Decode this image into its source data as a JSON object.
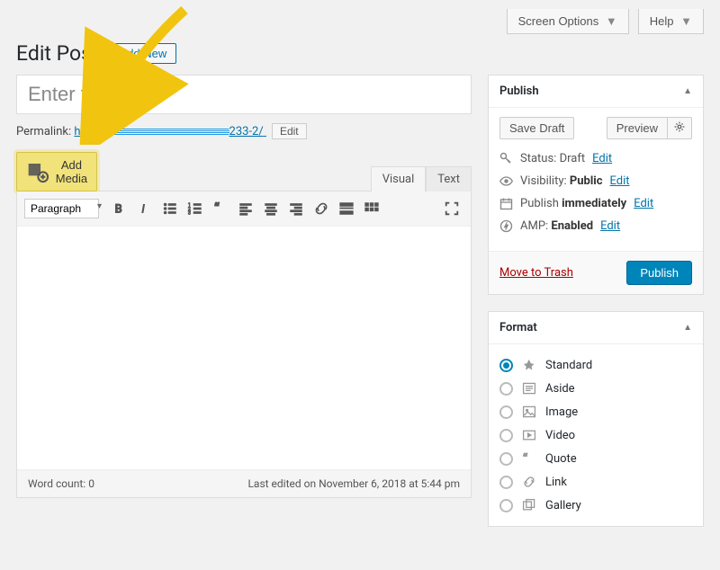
{
  "top": {
    "screen_options": "Screen Options",
    "help": "Help"
  },
  "page": {
    "title": "Edit Post",
    "add_new": "Add New"
  },
  "post": {
    "title_placeholder": "Enter title here",
    "permalink_label": "Permalink:",
    "permalink_prefix": "https://",
    "permalink_suffix": "233-2/",
    "permalink_edit": "Edit"
  },
  "editor": {
    "add_media": "Add Media",
    "tab_visual": "Visual",
    "tab_text": "Text",
    "format_select": "Paragraph",
    "word_count_label": "Word count:",
    "word_count": "0",
    "last_edited": "Last edited on November 6, 2018 at 5:44 pm"
  },
  "publish": {
    "head": "Publish",
    "save_draft": "Save Draft",
    "preview": "Preview",
    "status_label": "Status:",
    "status_value": "Draft",
    "visibility_label": "Visibility:",
    "visibility_value": "Public",
    "schedule_label": "Publish",
    "schedule_value": "immediately",
    "amp_label": "AMP:",
    "amp_value": "Enabled",
    "edit": "Edit",
    "trash": "Move to Trash",
    "publish_btn": "Publish"
  },
  "format": {
    "head": "Format",
    "items": [
      {
        "label": "Standard",
        "checked": true,
        "icon": "pin"
      },
      {
        "label": "Aside",
        "checked": false,
        "icon": "aside"
      },
      {
        "label": "Image",
        "checked": false,
        "icon": "image"
      },
      {
        "label": "Video",
        "checked": false,
        "icon": "video"
      },
      {
        "label": "Quote",
        "checked": false,
        "icon": "quote"
      },
      {
        "label": "Link",
        "checked": false,
        "icon": "link"
      },
      {
        "label": "Gallery",
        "checked": false,
        "icon": "gallery"
      }
    ]
  }
}
